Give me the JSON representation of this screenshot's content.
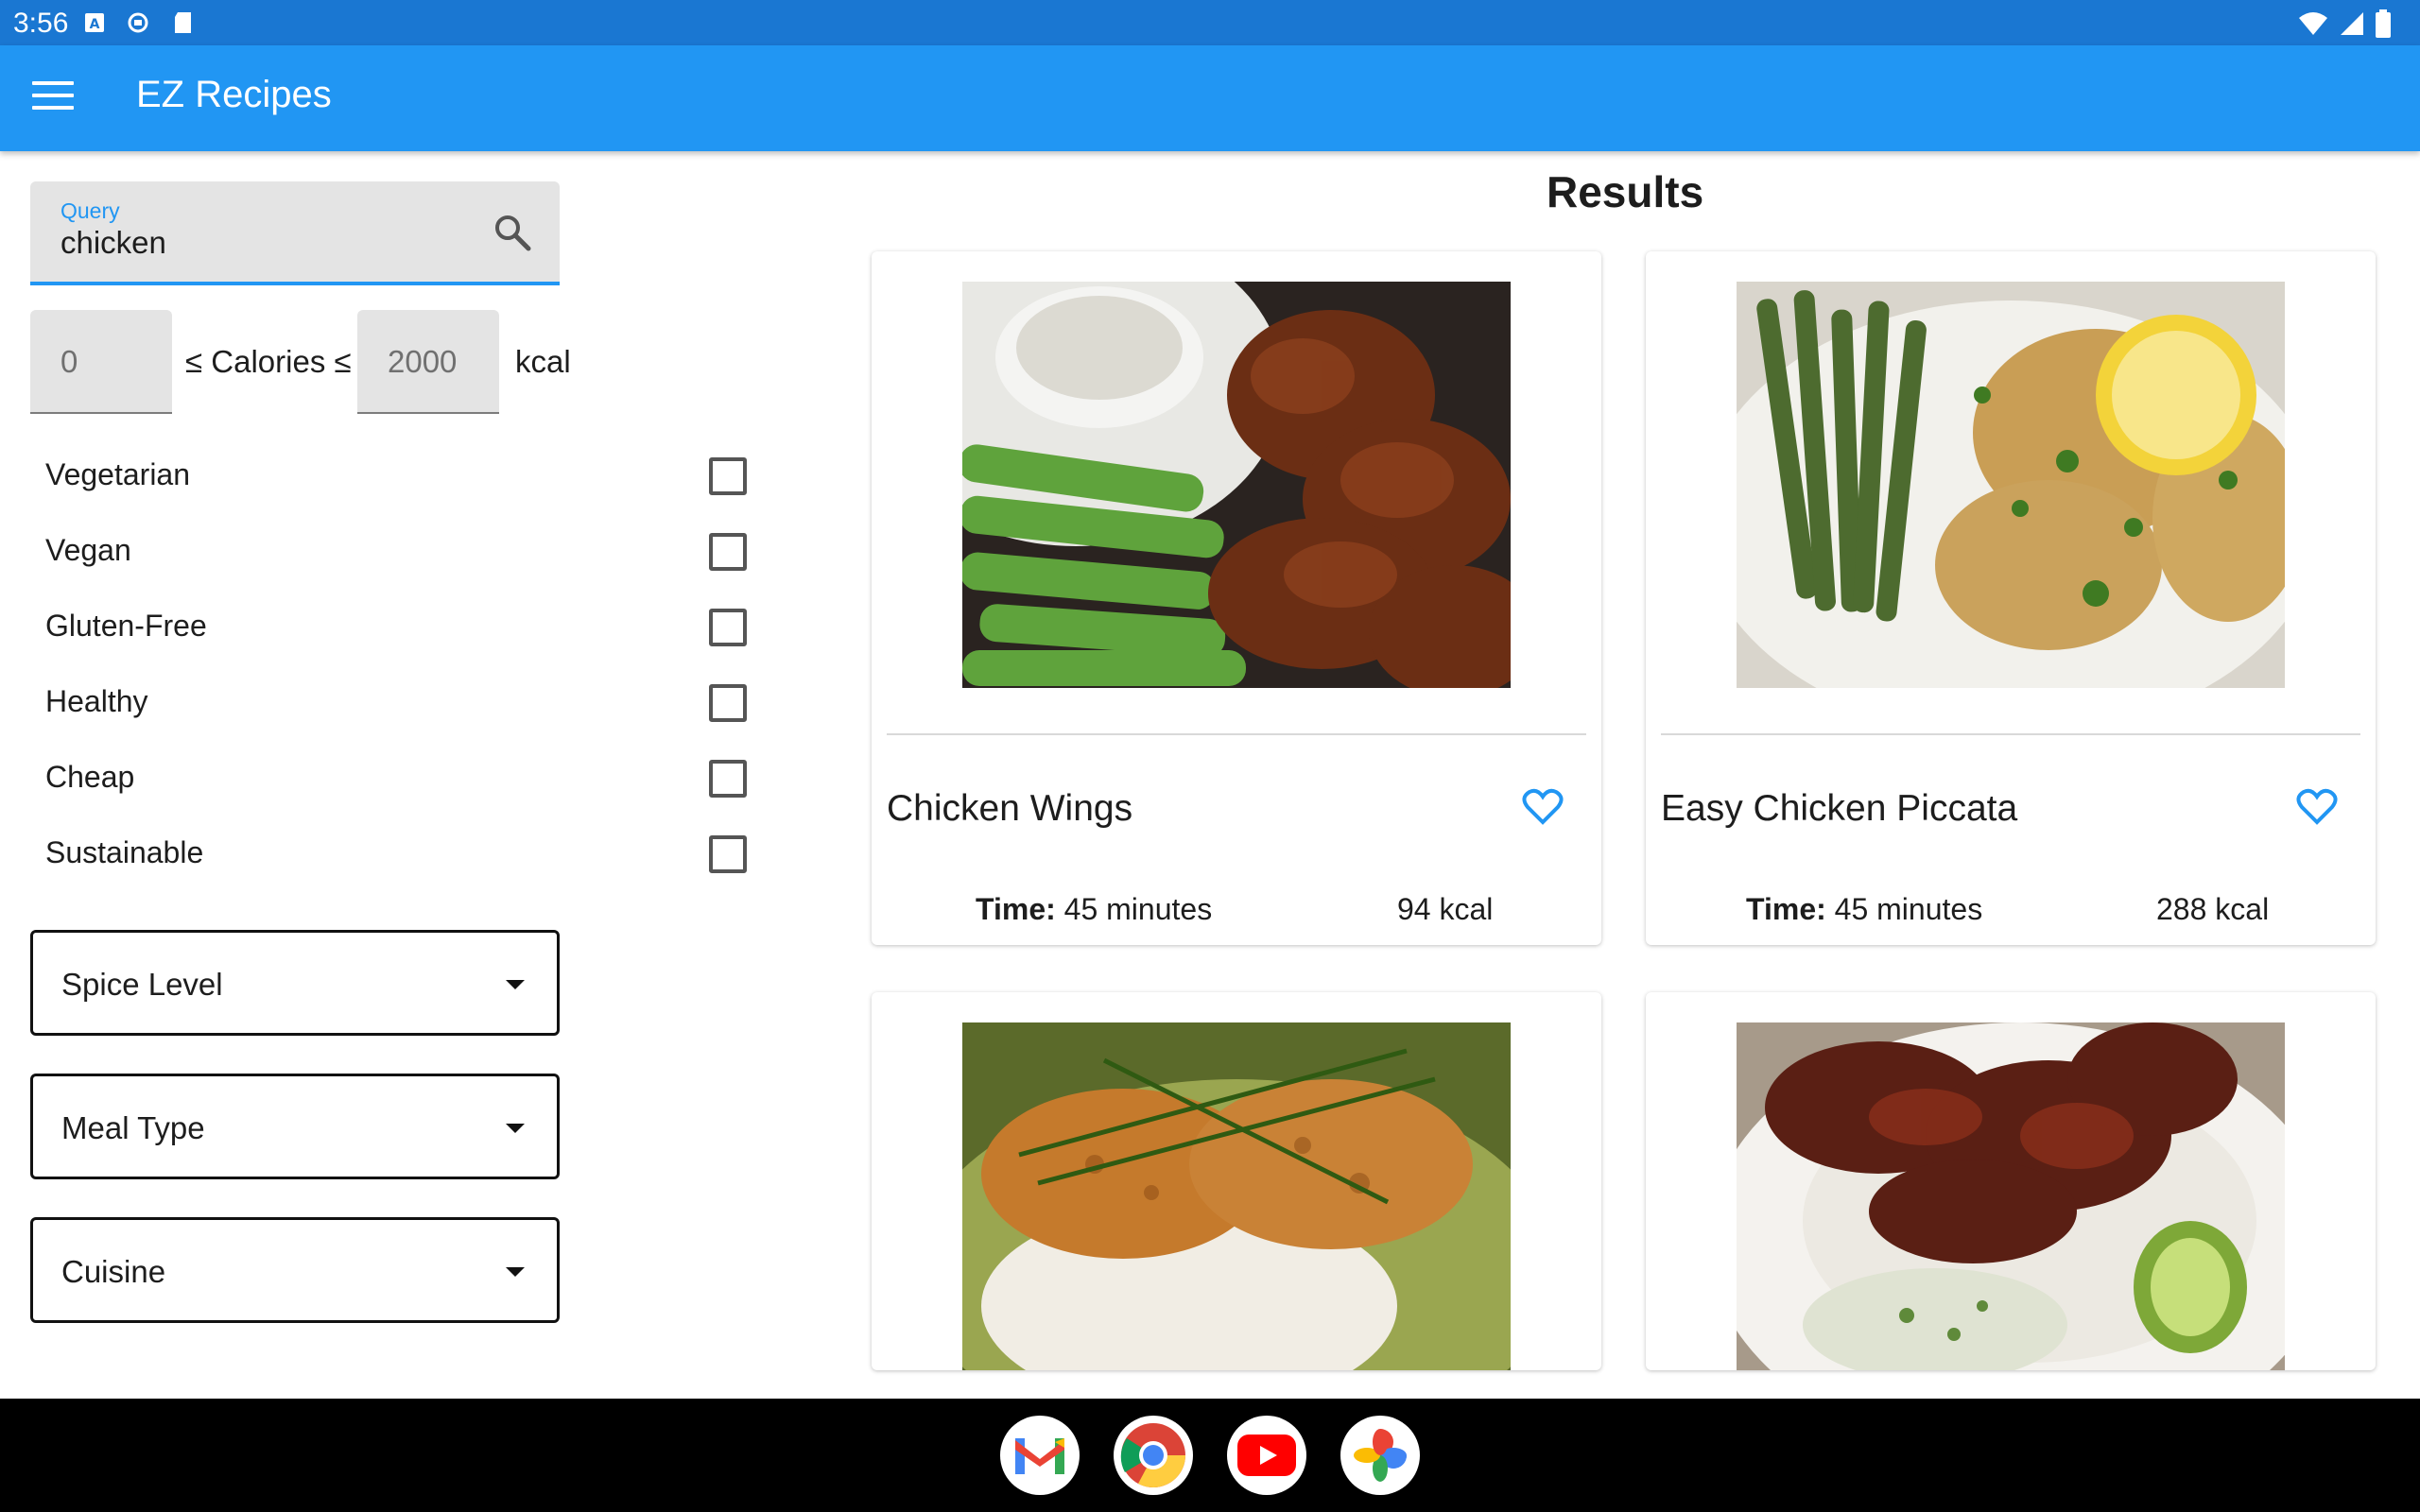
{
  "status_bar": {
    "time": "3:56"
  },
  "app_bar": {
    "title": "EZ Recipes"
  },
  "search": {
    "label": "Query",
    "value": "chicken"
  },
  "calories": {
    "min": "0",
    "label": "≤ Calories ≤",
    "max": "2000",
    "unit": "kcal"
  },
  "filters": [
    {
      "label": "Vegetarian",
      "checked": false
    },
    {
      "label": "Vegan",
      "checked": false
    },
    {
      "label": "Gluten-Free",
      "checked": false
    },
    {
      "label": "Healthy",
      "checked": false
    },
    {
      "label": "Cheap",
      "checked": false
    },
    {
      "label": "Sustainable",
      "checked": false
    }
  ],
  "dropdowns": {
    "spice": "Spice Level",
    "meal": "Meal Type",
    "cuisine": "Cuisine"
  },
  "results": {
    "title": "Results",
    "cards": [
      {
        "name": "Chicken Wings",
        "time_label": "Time:",
        "time": "45 minutes",
        "kcal": "94 kcal"
      },
      {
        "name": "Easy Chicken Piccata",
        "time_label": "Time:",
        "time": "45 minutes",
        "kcal": "288 kcal"
      }
    ]
  },
  "colors": {
    "primary": "#2196f3",
    "status_bar": "#1a77d2",
    "heart": "#2196f3"
  },
  "dock": [
    "gmail-icon",
    "chrome-icon",
    "youtube-icon",
    "photos-icon"
  ]
}
